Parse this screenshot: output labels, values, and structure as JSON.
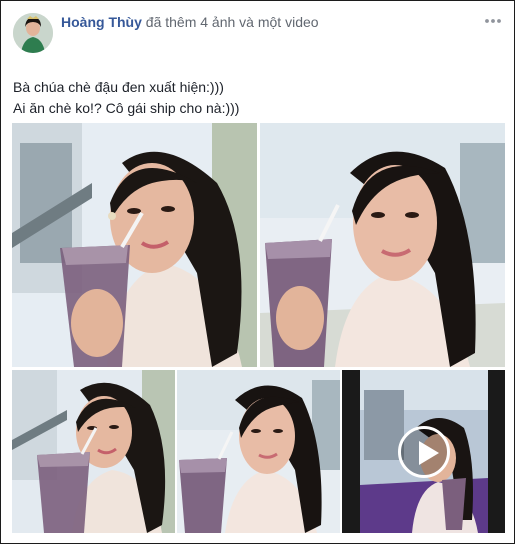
{
  "post": {
    "author": "Hoàng Thùy",
    "action": "đã thêm 4 ảnh và một video",
    "text_lines": [
      "Bà chúa chè đậu đen xuất hiện:)))",
      "Ai ăn chè ko!? Cô gái ship cho nà:)))"
    ]
  },
  "media": [
    {
      "kind": "photo",
      "icon": "photo-selfie-1"
    },
    {
      "kind": "photo",
      "icon": "photo-selfie-2"
    },
    {
      "kind": "photo",
      "icon": "photo-selfie-3"
    },
    {
      "kind": "photo",
      "icon": "photo-selfie-4"
    },
    {
      "kind": "video",
      "icon": "play-icon"
    }
  ],
  "colors": {
    "author_link": "#365899",
    "meta_text": "#616770",
    "body_text": "#1d2129"
  }
}
